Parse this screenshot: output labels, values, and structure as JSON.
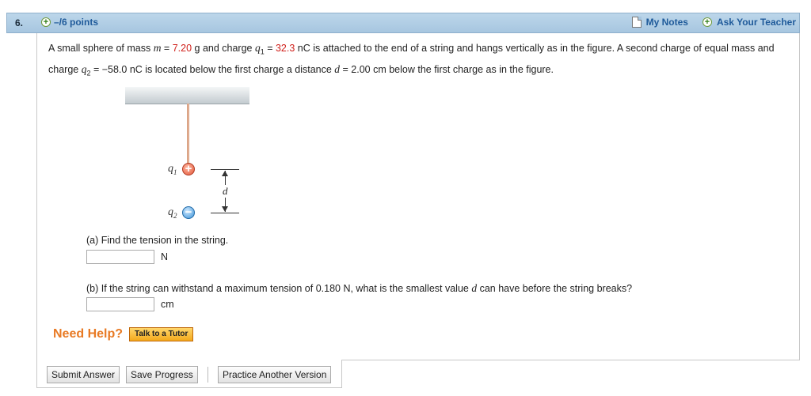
{
  "header": {
    "question_number": "6.",
    "points": "–/6 points",
    "my_notes": "My Notes",
    "ask_teacher": "Ask Your Teacher"
  },
  "problem": {
    "p1": "A small sphere of mass ",
    "m_sym": "m",
    "eq1": " = ",
    "m_val": "7.20",
    "p2": " g and charge ",
    "q1_sym": "q",
    "q1_sub": "1",
    "eq2": " = ",
    "q1_val": "32.3",
    "p3": " nC is attached to the end of a string and hangs vertically as in the figure. A second charge of equal mass and charge ",
    "q2_sym": "q",
    "q2_sub": "2",
    "p4": " = −58.0 nC is located below the first charge a distance ",
    "d_sym": "d",
    "p5": " = 2.00 cm below the first charge as in the figure."
  },
  "figure": {
    "q1_label": "q",
    "q1_sub": "1",
    "q2_label": "q",
    "q2_sub": "2",
    "pos_sign": "+",
    "neg_sign": "−",
    "d_label": "d"
  },
  "part_a": {
    "question": "(a) Find the tension in the string.",
    "unit": "N",
    "value": ""
  },
  "part_b": {
    "question_pre": "(b) If the string can withstand a maximum tension of 0.180 N, what is the smallest value ",
    "d_sym": "d",
    "question_post": " can have before the string breaks?",
    "unit": "cm",
    "value": ""
  },
  "help": {
    "need_help": "Need Help?",
    "tutor_button": "Talk to a Tutor"
  },
  "buttons": {
    "submit": "Submit Answer",
    "save": "Save Progress",
    "practice": "Practice Another Version"
  },
  "colors": {
    "header_bg": "#a7c6e0",
    "link_blue": "#1f5a9a",
    "value_red": "#d0201b",
    "help_orange": "#e87a24"
  }
}
